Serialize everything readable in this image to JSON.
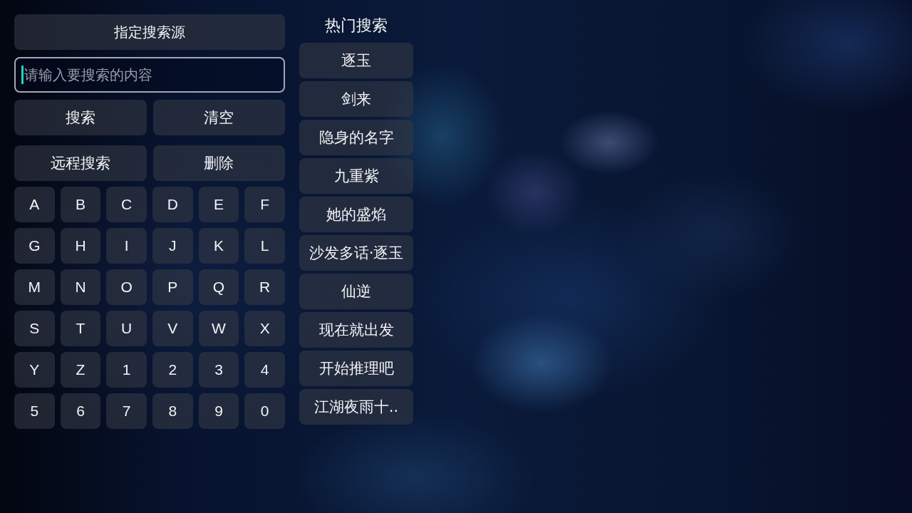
{
  "source_button": "指定搜索源",
  "search": {
    "placeholder": "请输入要搜索的内容",
    "focused": true
  },
  "actions": [
    "搜索",
    "清空",
    "远程搜索",
    "删除"
  ],
  "keys": [
    "A",
    "B",
    "C",
    "D",
    "E",
    "F",
    "G",
    "H",
    "I",
    "J",
    "K",
    "L",
    "M",
    "N",
    "O",
    "P",
    "Q",
    "R",
    "S",
    "T",
    "U",
    "V",
    "W",
    "X",
    "Y",
    "Z",
    "1",
    "2",
    "3",
    "4",
    "5",
    "6",
    "7",
    "8",
    "9",
    "0"
  ],
  "hot_search": {
    "title": "热门搜索",
    "items": [
      "逐玉",
      "剑来",
      "隐身的名字",
      "九重紫",
      "她的盛焰",
      "沙发多话·逐玉",
      "仙逆",
      "现在就出发",
      "开始推理吧",
      "江湖夜雨十.."
    ]
  }
}
